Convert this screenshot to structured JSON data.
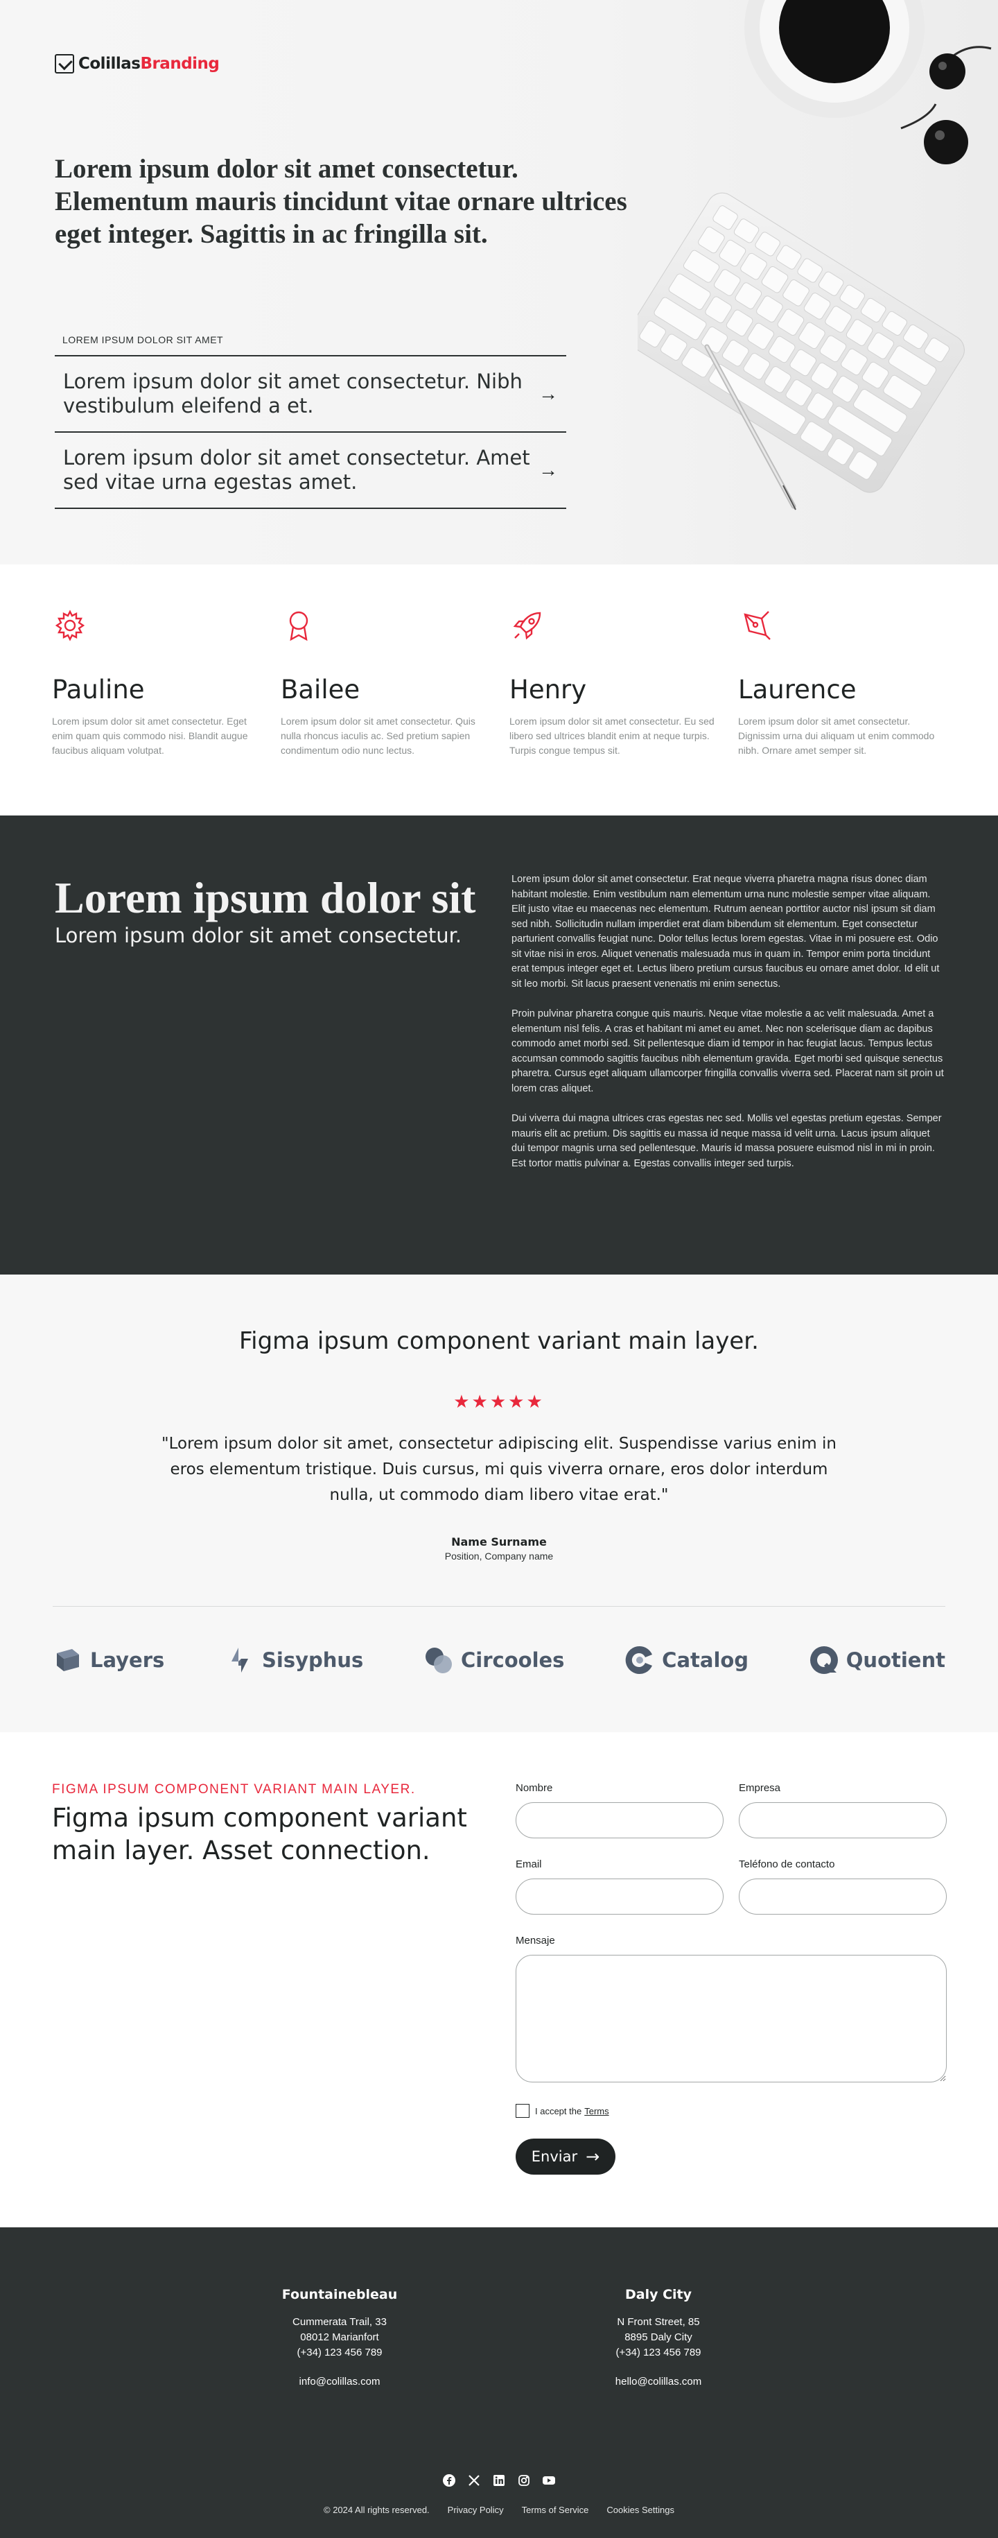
{
  "brand": {
    "name_part1": "Colillas",
    "name_part2": "Branding",
    "accent": "#e8283c"
  },
  "hero": {
    "title": "Lorem ipsum dolor sit amet consectetur. Elementum mauris tincidunt vitae ornare ultrices eget integer. Sagittis in ac fringilla sit.",
    "eyebrow": "LOREM IPSUM DOLOR SIT AMET",
    "links": [
      {
        "label": "Lorem ipsum dolor sit amet consectetur. Nibh vestibulum eleifend a et.",
        "icon": "arrow-right-icon"
      },
      {
        "label": "Lorem ipsum dolor sit amet consectetur. Amet sed vitae urna egestas amet.",
        "icon": "arrow-right-icon"
      }
    ]
  },
  "features": [
    {
      "icon": "gear-icon",
      "title": "Pauline",
      "text": "Lorem ipsum dolor sit amet consectetur. Eget enim quam quis commodo nisi. Blandit augue faucibus aliquam volutpat."
    },
    {
      "icon": "award-ribbon-icon",
      "title": "Bailee",
      "text": "Lorem ipsum dolor sit amet consectetur. Quis nulla rhoncus iaculis ac. Sed pretium sapien condimentum odio nunc lectus."
    },
    {
      "icon": "rocket-icon",
      "title": "Henry",
      "text": "Lorem ipsum dolor sit amet consectetur. Eu sed libero sed ultrices blandit enim at neque turpis. Turpis congue tempus sit."
    },
    {
      "icon": "pen-tool-icon",
      "title": "Laurence",
      "text": "Lorem ipsum dolor sit amet consectetur. Dignissim urna dui aliquam ut enim commodo nibh. Ornare amet semper sit."
    }
  ],
  "about": {
    "title": "Lorem ipsum dolor sit",
    "subtitle": "Lorem ipsum dolor sit amet consectetur.",
    "paragraphs": [
      "Lorem ipsum dolor sit amet consectetur. Erat neque viverra pharetra magna risus donec diam habitant molestie. Enim vestibulum nam elementum urna nunc molestie semper vitae aliquam. Elit justo vitae eu maecenas nec elementum. Rutrum aenean porttitor auctor nisl ipsum sit diam sed nibh. Sollicitudin nullam imperdiet erat diam bibendum sit elementum. Eget consectetur parturient convallis feugiat nunc. Dolor tellus lectus lorem egestas. Vitae in mi posuere est. Odio sit vitae nisi in eros. Aliquet venenatis malesuada mus in quam in. Tempor enim porta tincidunt erat tempus integer eget et. Lectus libero pretium cursus faucibus eu ornare amet dolor. Id elit ut sit leo morbi. Sit lacus praesent venenatis mi enim senectus.",
      "Proin pulvinar pharetra congue quis mauris. Neque vitae molestie a ac velit malesuada. Amet a elementum nisl felis. A cras et habitant mi amet eu amet. Nec non scelerisque diam ac dapibus commodo amet morbi sed. Sit pellentesque diam id tempor in hac feugiat lacus. Tempus lectus accumsan commodo sagittis faucibus nibh elementum gravida. Eget morbi sed quisque senectus pharetra. Cursus eget aliquam ullamcorper fringilla convallis viverra sed. Placerat nam sit proin ut lorem cras aliquet.",
      "Dui viverra dui magna ultrices cras egestas nec sed. Mollis vel egestas pretium egestas. Semper mauris elit ac pretium. Dis sagittis eu massa id neque massa id velit urna. Lacus ipsum aliquet dui tempor magnis urna sed pellentesque. Mauris id massa posuere euismod nisl in mi in proin. Est tortor mattis pulvinar a. Egestas convallis integer sed turpis."
    ]
  },
  "testimonial": {
    "heading": "Figma ipsum component variant main layer.",
    "rating": 5,
    "stars": "★★★★★",
    "quote": "\"Lorem ipsum dolor sit amet, consectetur adipiscing elit. Suspendisse varius enim in eros elementum tristique. Duis cursus, mi quis viverra ornare, eros dolor interdum nulla, ut commodo diam libero vitae erat.\"",
    "name": "Name Surname",
    "role": "Position, Company name"
  },
  "client_logos": [
    {
      "name": "Layers",
      "icon": "layers-logo-icon"
    },
    {
      "name": "Sisyphus",
      "icon": "sisyphus-logo-icon"
    },
    {
      "name": "Circooles",
      "icon": "circooles-logo-icon"
    },
    {
      "name": "Catalog",
      "icon": "catalog-logo-icon"
    },
    {
      "name": "Quotient",
      "icon": "quotient-logo-icon"
    }
  ],
  "contact": {
    "eyebrow": "FIGMA IPSUM COMPONENT VARIANT MAIN LAYER.",
    "title": "Figma ipsum component variant main layer. Asset connection.",
    "fields": {
      "name": {
        "label": "Nombre",
        "value": ""
      },
      "company": {
        "label": "Empresa",
        "value": ""
      },
      "email": {
        "label": "Email",
        "value": ""
      },
      "phone": {
        "label": "Teléfono de contacto",
        "value": ""
      },
      "message": {
        "label": "Mensaje",
        "value": ""
      }
    },
    "terms_prefix": "I accept the",
    "terms_link": "Terms",
    "submit_label": "Enviar"
  },
  "footer": {
    "offices": [
      {
        "city": "Fountainebleau",
        "street": "Cummerata Trail, 33",
        "postal": "08012 Marianfort",
        "phone": "(+34) 123 456 789",
        "email": "info@colillas.com"
      },
      {
        "city": "Daly City",
        "street": "N Front Street, 85",
        "postal": "8895 Daly City",
        "phone": "(+34) 123 456 789",
        "email": "hello@colillas.com"
      }
    ],
    "socials": [
      "facebook-icon",
      "x-icon",
      "linkedin-icon",
      "instagram-icon",
      "youtube-icon"
    ],
    "copyright": "© 2024 All rights reserved.",
    "links": [
      "Privacy Policy",
      "Terms of Service",
      "Cookies Settings"
    ]
  }
}
